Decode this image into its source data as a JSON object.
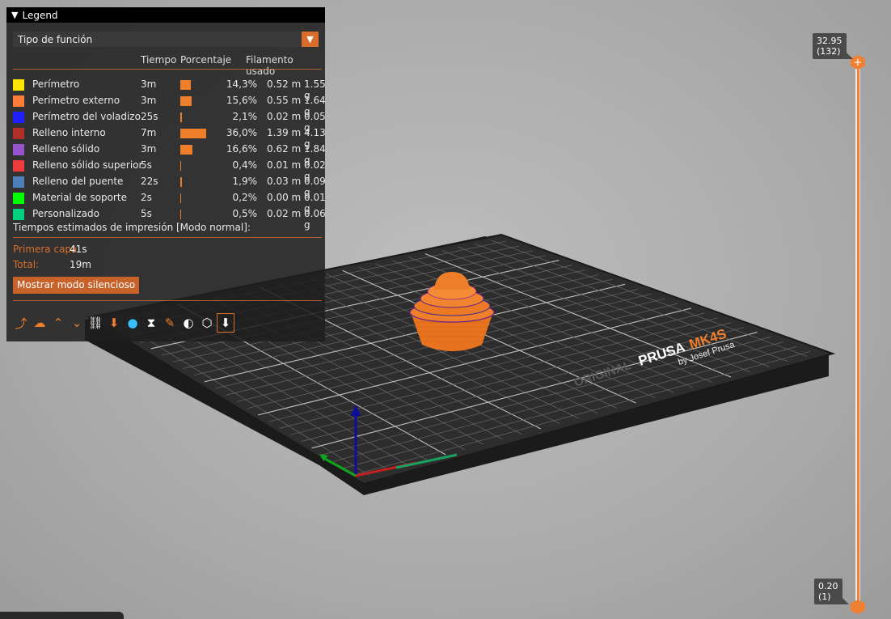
{
  "legend": {
    "title": "Legend",
    "view_type": "Tipo de función",
    "columns": {
      "time": "Tiempo",
      "percent": "Porcentaje",
      "filament": "Filamento usado"
    },
    "features": [
      {
        "name": "Perímetro",
        "time": "3m",
        "pct_value": 14.3,
        "pct": "14,3%",
        "length": "0.52 m",
        "weight": "1.55 g",
        "color": "#ffe600"
      },
      {
        "name": "Perímetro externo",
        "time": "3m",
        "pct_value": 15.6,
        "pct": "15,6%",
        "length": "0.55 m",
        "weight": "1.64 g",
        "color": "#ff7d38"
      },
      {
        "name": "Perímetro del voladizo",
        "time": "25s",
        "pct_value": 2.1,
        "pct": "2,1%",
        "length": "0.02 m",
        "weight": "0.05 g",
        "color": "#1f1fff"
      },
      {
        "name": "Relleno interno",
        "time": "7m",
        "pct_value": 36.0,
        "pct": "36,0%",
        "length": "1.39 m",
        "weight": "4.13 g",
        "color": "#b03029"
      },
      {
        "name": "Relleno sólido",
        "time": "3m",
        "pct_value": 16.6,
        "pct": "16,6%",
        "length": "0.62 m",
        "weight": "1.84 g",
        "color": "#9654cc"
      },
      {
        "name": "Relleno sólido superior",
        "time": "5s",
        "pct_value": 0.4,
        "pct": "0,4%",
        "length": "0.01 m",
        "weight": "0.02 g",
        "color": "#f03c3c"
      },
      {
        "name": "Relleno del puente",
        "time": "22s",
        "pct_value": 1.9,
        "pct": "1,9%",
        "length": "0.03 m",
        "weight": "0.09 g",
        "color": "#4d80ba"
      },
      {
        "name": "Material de soporte",
        "time": "2s",
        "pct_value": 0.2,
        "pct": "0,2%",
        "length": "0.00 m",
        "weight": "0.01 g",
        "color": "#00ff00"
      },
      {
        "name": "Personalizado",
        "time": "5s",
        "pct_value": 0.5,
        "pct": "0,5%",
        "length": "0.02 m",
        "weight": "0.06 g",
        "color": "#00d17f"
      }
    ],
    "estimates_title": "Tiempos estimados de impresión [Modo normal]:",
    "first_layer_label": "Primera capa:",
    "first_layer_value": "41s",
    "total_label": "Total:",
    "total_value": "19m",
    "silent_button": "Mostrar modo silencioso",
    "toolbar_icons": [
      "travel-icon",
      "wipe-icon",
      "retractions-icon",
      "deretractions-icon",
      "seams-icon",
      "tool-changes-icon",
      "color-changes-icon",
      "pause-icon",
      "custom-gcode-icon",
      "cog-icon",
      "shells-icon",
      "tool-marker-icon"
    ]
  },
  "slider": {
    "top_value": "32.95",
    "top_layer": "(132)",
    "bottom_value": "0.20",
    "bottom_layer": "(1)",
    "top_symbol": "+"
  },
  "bed": {
    "brand_text_1": "ORIGINAL",
    "brand_text_2": "PRUSA",
    "brand_text_3": "MK4S",
    "brand_text_4": "by Josef Prusa"
  },
  "colors": {
    "accent": "#d96e2c",
    "model": "#f07f2c"
  }
}
